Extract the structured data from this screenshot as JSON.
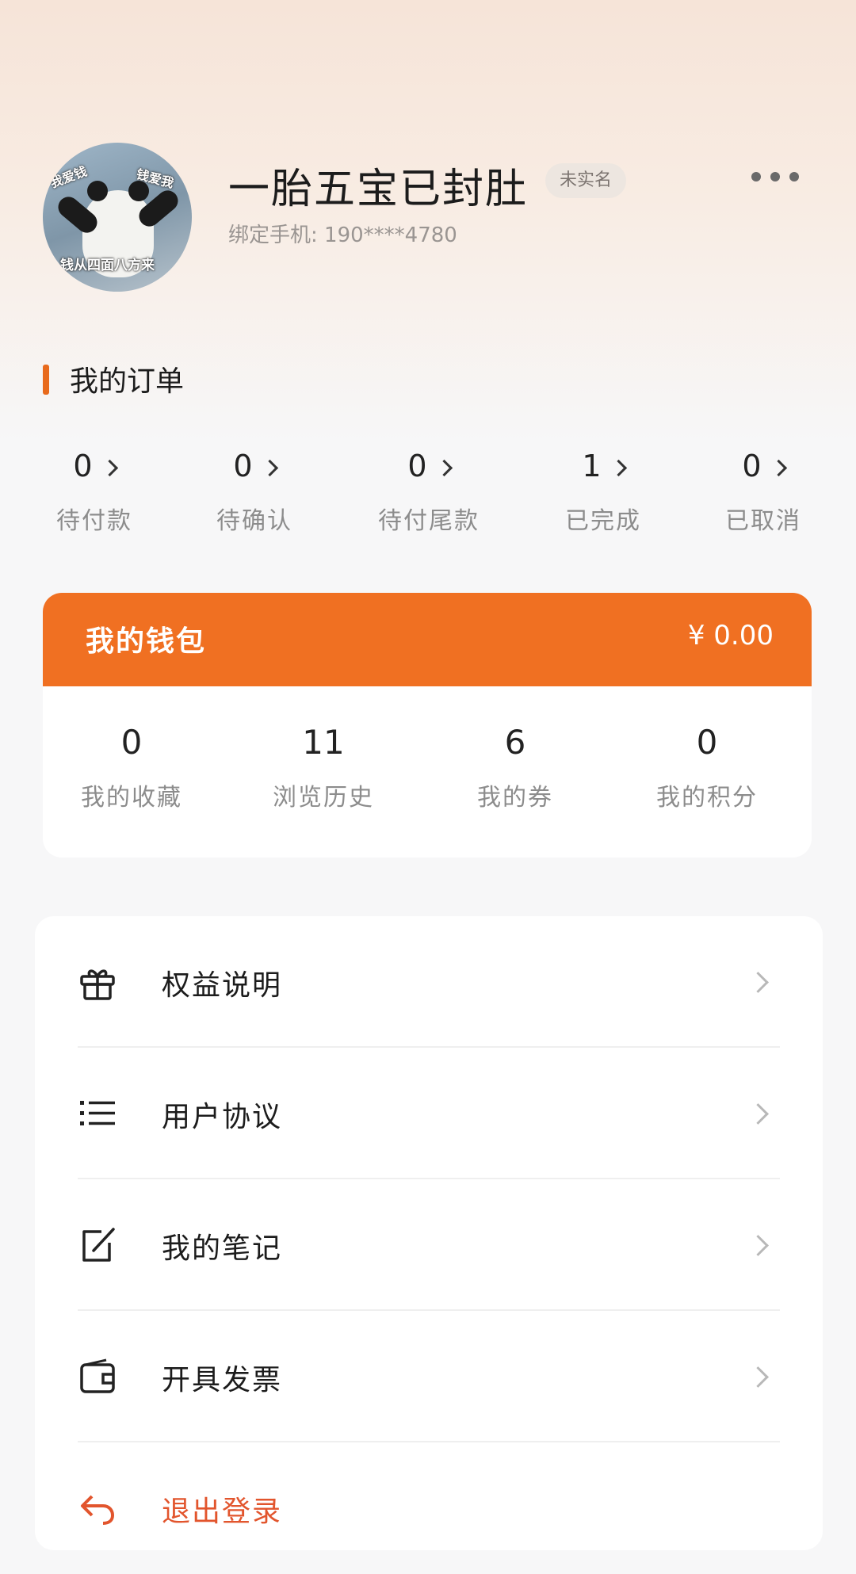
{
  "profile": {
    "avatar_captions": [
      "我爱钱",
      "钱爱我",
      "钱从四面八方来"
    ],
    "username": "一胎五宝已封肚",
    "verify_status": "未实名",
    "phone": "绑定手机: 190****4780",
    "more_icon": "more-dots-icon"
  },
  "orders": {
    "title": "我的订单",
    "accent_color": "#e86a1c",
    "items": [
      {
        "count": "0",
        "label": "待付款"
      },
      {
        "count": "0",
        "label": "待确认"
      },
      {
        "count": "0",
        "label": "待付尾款"
      },
      {
        "count": "1",
        "label": "已完成"
      },
      {
        "count": "0",
        "label": "已取消"
      }
    ]
  },
  "wallet": {
    "title": "我的钱包",
    "amount": "¥ 0.00",
    "header_color": "#f07022",
    "stats": [
      {
        "value": "0",
        "label": "我的收藏"
      },
      {
        "value": "11",
        "label": "浏览历史"
      },
      {
        "value": "6",
        "label": "我的券"
      },
      {
        "value": "0",
        "label": "我的积分"
      }
    ]
  },
  "menu": [
    {
      "label": "权益说明",
      "icon": "gift-icon"
    },
    {
      "label": "用户协议",
      "icon": "list-icon"
    },
    {
      "label": "我的笔记",
      "icon": "edit-note-icon"
    },
    {
      "label": "开具发票",
      "icon": "wallet-icon"
    },
    {
      "label": "退出登录",
      "icon": "logout-icon",
      "color": "#e2552d"
    }
  ]
}
